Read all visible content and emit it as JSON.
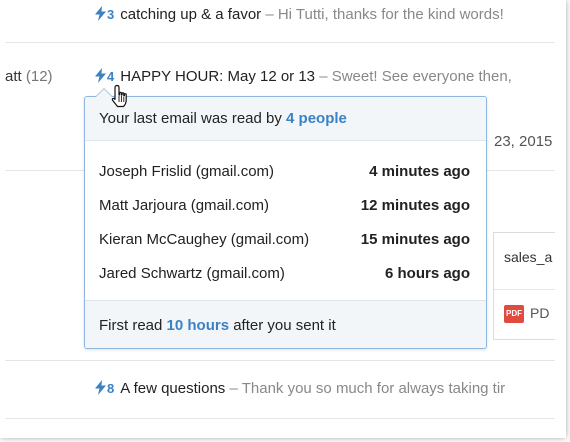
{
  "rows": [
    {
      "sender": "",
      "sender_count": "",
      "open_count": "3",
      "subject": "catching up & a favor",
      "snippet": " – Hi Tutti, thanks for the kind words!"
    },
    {
      "sender": "att",
      "sender_count": "(12)",
      "open_count": "4",
      "subject": "HAPPY HOUR: May 12 or 13",
      "snippet": " – Sweet! See everyone then,"
    },
    {
      "sender": "",
      "sender_count": "",
      "open_count": "8",
      "subject": "A few questions",
      "snippet": " – Thank you so much for always taking tir"
    }
  ],
  "faded_date": "23, 2015",
  "attachment": {
    "name": "sales_a",
    "type_badge": "PDF",
    "type_text": "PD"
  },
  "popover": {
    "header_prefix": "Your last email was read by ",
    "header_count": "4 people",
    "readers": [
      {
        "name": "Joseph Frislid (gmail.com)",
        "time": "4 minutes ago"
      },
      {
        "name": "Matt Jarjoura (gmail.com)",
        "time": "12 minutes ago"
      },
      {
        "name": "Kieran McCaughey (gmail.com)",
        "time": "15 minutes ago"
      },
      {
        "name": "Jared Schwartz (gmail.com)",
        "time": "6 hours ago"
      }
    ],
    "footer_prefix": "First read ",
    "footer_highlight": "10 hours",
    "footer_suffix": " after you sent it"
  },
  "colors": {
    "accent": "#3b82c4",
    "pdf_badge": "#e04a3f"
  },
  "icons": {
    "open_tracker": "lightning-bolt-icon",
    "cursor": "hand-pointer-icon",
    "pdf": "pdf-file-icon"
  }
}
